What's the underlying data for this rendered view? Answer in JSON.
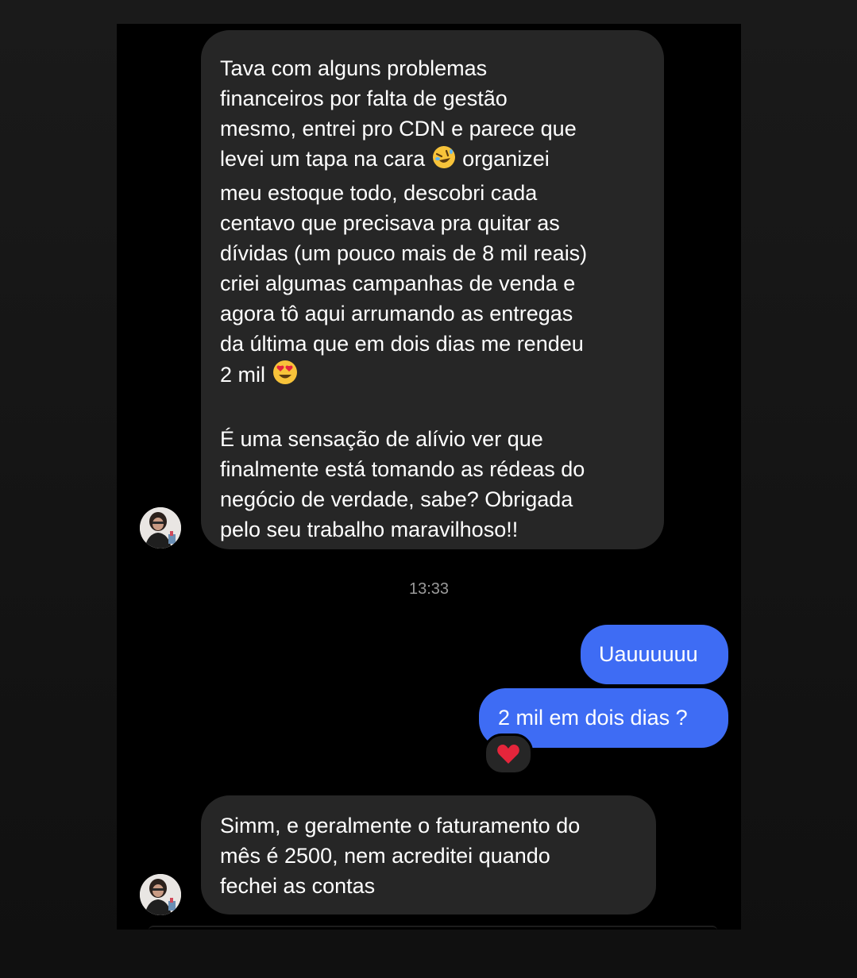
{
  "conversation": {
    "msg1": {
      "paragraph1_before_emoji": "Tava com alguns problemas\nfinanceiros por falta de gestão\nmesmo, entrei pro CDN e parece que\nlevei um tapa na cara ",
      "emoji1": "rolling-on-floor-laughing-emoji",
      "paragraph1_middle": " organizei\nmeu estoque todo, descobri cada\ncentavo que precisava pra quitar as\ndívidas (um pouco mais de 8 mil reais)\ncriei algumas campanhas de venda e\nagora tô aqui arrumando as entregas\nda última que em dois dias me rendeu\n2 mil ",
      "emoji2": "heart-eyes-emoji",
      "paragraph2": "É uma sensação de alívio ver que\nfinalmente está tomando as rédeas do\nnegócio de verdade, sabe? Obrigada\npelo seu trabalho maravilhoso!!"
    },
    "timestamp": "13:33",
    "msg2": "Uauuuuuu",
    "msg3": "2 mil em dois dias ?",
    "msg3_reaction": "red-heart-emoji",
    "msg4": "Simm, e geralmente o faturamento do\nmês é 2500, nem acreditei quando\nfechei as contas"
  },
  "colors": {
    "page_background": "#151515",
    "chat_background": "#000000",
    "incoming_bubble": "#262626",
    "outgoing_bubble": "#3e6cf4",
    "text": "#ffffff",
    "timestamp": "#9a9a9a"
  }
}
